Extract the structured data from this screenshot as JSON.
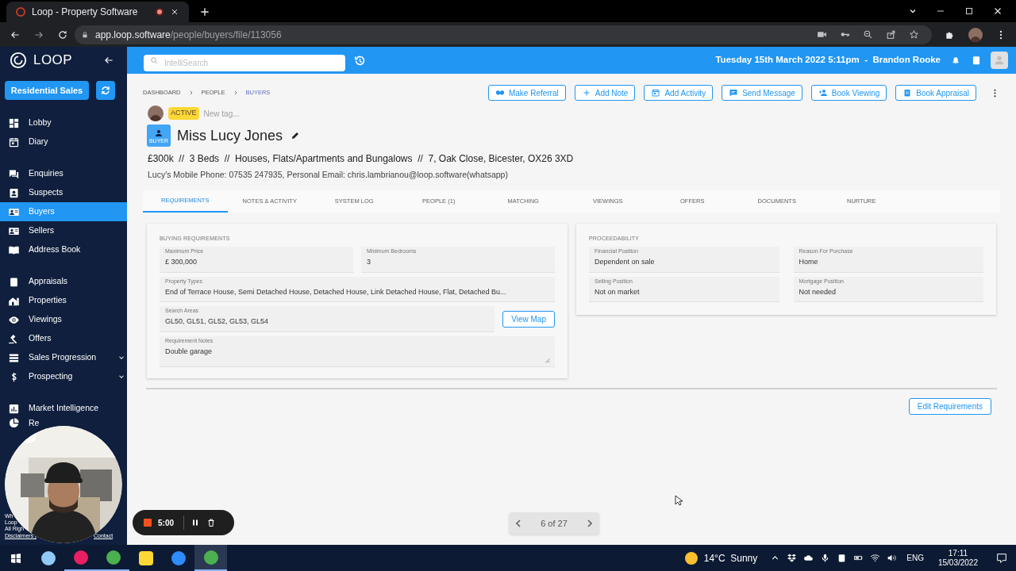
{
  "browser": {
    "tab_title": "Loop - Property Software",
    "url_host": "app.loop.software",
    "url_path": "/people/buyers/file/113056"
  },
  "header": {
    "search": {
      "placeholder": "IntelliSearch"
    },
    "date_user": "Tuesday 15th March 2022 5:11pm  -  Brandon Rooke"
  },
  "sidebar": {
    "brand": "LOOP",
    "team_button": "Residential Sales",
    "groups": [
      [
        {
          "label": "Lobby",
          "selected": false
        },
        {
          "label": "Diary",
          "selected": false
        }
      ],
      [
        {
          "label": "Enquiries",
          "selected": false
        },
        {
          "label": "Suspects",
          "selected": false
        },
        {
          "label": "Buyers",
          "selected": true
        },
        {
          "label": "Sellers",
          "selected": false
        },
        {
          "label": "Address Book",
          "selected": false
        }
      ],
      [
        {
          "label": "Appraisals",
          "selected": false
        },
        {
          "label": "Properties",
          "selected": false
        },
        {
          "label": "Viewings",
          "selected": false
        },
        {
          "label": "Offers",
          "selected": false
        },
        {
          "label": "Sales Progression",
          "selected": false,
          "expanded": false
        },
        {
          "label": "Prospecting",
          "selected": false,
          "expanded": false
        }
      ],
      [
        {
          "label": "Market Intelligence",
          "selected": false
        },
        {
          "label": "Re",
          "selected": false
        }
      ]
    ],
    "footer": [
      "Wh",
      "Loop",
      "All Righ",
      "Disclaimers |",
      "Contact"
    ]
  },
  "breadcrumbs": [
    "DASHBOARD",
    "PEOPLE",
    "BUYERS"
  ],
  "actions": [
    "Make Referral",
    "Add Note",
    "Add Activity",
    "Send Message",
    "Book Viewing",
    "Book Appraisal"
  ],
  "record": {
    "status": "ACTIVE",
    "tag_placeholder": "New tag...",
    "type_badge": "BUYER",
    "name": "Miss Lucy Jones",
    "summary": "£300k  //  3 Beds  //  Houses, Flats/Apartments and Bungalows  //  7, Oak Close, Bicester, OX26 3XD",
    "contact": "Lucy's Mobile Phone: 07535 247935, Personal Email: chris.lambrianou@loop.software(whatsapp)"
  },
  "tabs": [
    {
      "label": "REQUIREMENTS",
      "selected": true
    },
    {
      "label": "NOTES & ACTIVITY",
      "selected": false
    },
    {
      "label": "SYSTEM LOG",
      "selected": false
    },
    {
      "label": "PEOPLE (1)",
      "selected": false
    },
    {
      "label": "MATCHING",
      "selected": false
    },
    {
      "label": "VIEWINGS",
      "selected": false
    },
    {
      "label": "OFFERS",
      "selected": false
    },
    {
      "label": "DOCUMENTS",
      "selected": false
    },
    {
      "label": "NURTURE",
      "selected": false
    }
  ],
  "buying_requirements": {
    "title": "BUYING REQUIREMENTS",
    "maximum_price": {
      "label": "Maximum Price",
      "value": "£ 300,000"
    },
    "minimum_bedrooms": {
      "label": "Minimum Bedrooms",
      "value": "3"
    },
    "property_types": {
      "label": "Property Types",
      "value": "End of Terrace House, Semi Detached House, Detached House, Link Detached House, Flat, Detached Bu..."
    },
    "search_areas": {
      "label": "Search Areas",
      "value": "GL50, GL51, GL52, GL53, GL54"
    },
    "view_map_button": "View Map",
    "requirement_notes": {
      "label": "Requirement Notes",
      "value": "Double garage"
    }
  },
  "proceedability": {
    "title": "PROCEEDABILITY",
    "fields": [
      {
        "label": "Financial Position",
        "value": "Dependent on sale"
      },
      {
        "label": "Reason For Purchase",
        "value": "Home"
      },
      {
        "label": "Selling Position",
        "value": "Not on market"
      },
      {
        "label": "Mortgage Position",
        "value": "Not needed"
      }
    ]
  },
  "edit_button": "Edit Requirements",
  "pager": "6 of 27",
  "recorder": {
    "time": "5:00"
  },
  "taskbar": {
    "weather": "14°C  Sunny",
    "language": "ENG",
    "time": "17:11",
    "date": "15/03/2022"
  }
}
